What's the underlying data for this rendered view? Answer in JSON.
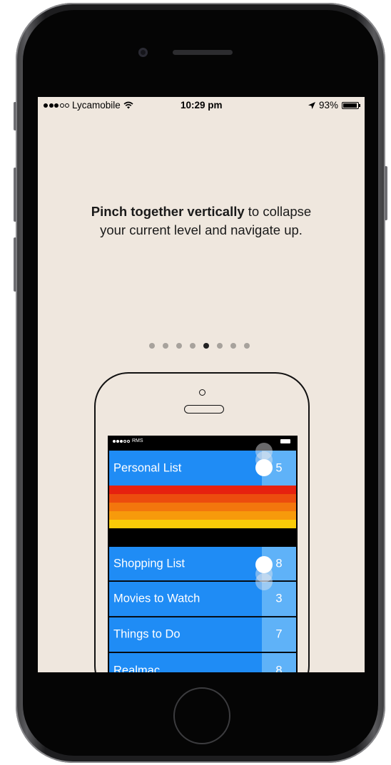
{
  "status_bar": {
    "carrier": "Lycamobile",
    "time": "10:29 pm",
    "battery": "93%"
  },
  "tutorial": {
    "bold_text": "Pinch together vertically",
    "rest_text": " to collapse your current level and navigate up.",
    "page_count": 8,
    "current_page": 5
  },
  "demo_phone": {
    "carrier": "RMS",
    "lists": [
      {
        "name": "Personal List",
        "count": "5"
      },
      {
        "name": "Shopping List",
        "count": "8"
      },
      {
        "name": "Movies to Watch",
        "count": "3"
      },
      {
        "name": "Things to Do",
        "count": "7"
      },
      {
        "name": "Realmac",
        "count": "8"
      }
    ],
    "stripe_colors": [
      "#e6210f",
      "#ec4c0e",
      "#f3760d",
      "#f79a0b",
      "#facb08"
    ],
    "row_color": "#1f8cf5",
    "count_cell_color": "#5fb2f8"
  }
}
